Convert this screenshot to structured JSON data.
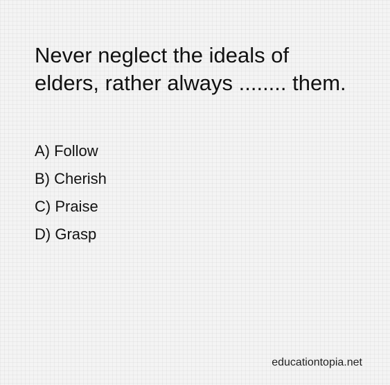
{
  "question": {
    "text": "Never neglect the ideals of elders, rather always ........ them."
  },
  "options": [
    {
      "label": "A) Follow"
    },
    {
      "label": "B) Cherish"
    },
    {
      "label": "C) Praise"
    },
    {
      "label": "D) Grasp"
    }
  ],
  "footer": {
    "site": "educationtopia.net"
  },
  "colors": {
    "background": "#f4f4f4",
    "text": "#111111"
  }
}
